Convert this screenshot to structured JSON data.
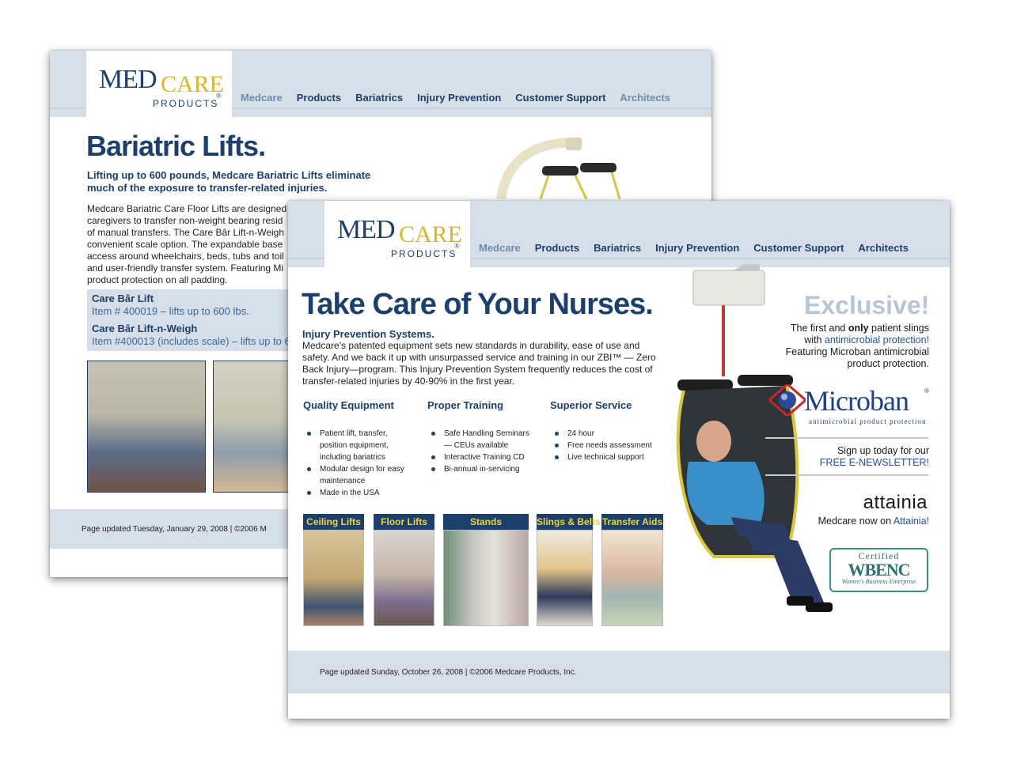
{
  "brand": {
    "med": "MED",
    "care": "CARE",
    "reg": "®",
    "products": "PRODUCTS"
  },
  "nav": [
    "Medcare",
    "Products",
    "Bariatrics",
    "Injury Prevention",
    "Customer Support",
    "Architects"
  ],
  "back": {
    "title": "Bariatric Lifts.",
    "subtitle": "Lifting up to 600 pounds, Medcare Bariatric Lifts eliminate much of the exposure to transfer-related injuries.",
    "lines": [
      "Medcare Bariatric Care Floor Lifts are designed",
      "caregivers to transfer non-weight bearing resid",
      "of manual transfers. The Care Bâr Lift-n-Weigh",
      "convenient scale option. The expandable base",
      "access around wheelchairs, beds, tubs and toil",
      "and user-friendly transfer system. Featuring Mi",
      "product protection on all padding."
    ],
    "products": [
      {
        "name": "Care Bâr Lift",
        "desc": "Item # 400019 – lifts up to 600 lbs."
      },
      {
        "name": "Care Bâr Lift-n-Weigh",
        "desc": "Item #400013 (includes scale) – lifts up to 6"
      }
    ],
    "footer": "Page updated Tuesday, January 29, 2008   |   ©2006 M"
  },
  "front": {
    "title": "Take Care of Your Nurses.",
    "intro_heading": "Injury Prevention Systems.",
    "intro_lines": [
      "Medcare's patented equipment sets new standards in durability, ease of use and",
      "safety. And we back it up with unsurpassed service and training in our ZBI™ — Zero",
      "Back Injury—program. This Injury Prevention System frequently reduces the cost of",
      "transfer-related injuries by 40-90% in the first year."
    ],
    "columns": [
      {
        "heading": "Quality Equipment",
        "items": [
          "Patient lift, transfer,",
          "position equipment,",
          "including bariatrics",
          "Modular design for easy",
          "maintenance",
          "Made in the USA"
        ],
        "bullets": [
          0,
          3,
          5
        ]
      },
      {
        "heading": "Proper Training",
        "items": [
          "Safe Handling Seminars",
          "— CEUs available",
          "Interactive Training CD",
          "Bi-annual in-servicing"
        ],
        "bullets": [
          0,
          2,
          3
        ]
      },
      {
        "heading": "Superior Service",
        "items": [
          "24 hour",
          "Free needs assessment",
          "Live technical support"
        ],
        "bullets": [
          0,
          1,
          2
        ]
      }
    ],
    "categories": [
      "Ceiling Lifts",
      "Floor Lifts",
      "Stands",
      "Slings & Belts",
      "Transfer Aids"
    ],
    "exclusive": "Exclusive!",
    "excl_lines": {
      "a": "The first and ",
      "only": "only",
      "b": " patient slings",
      "c": "with ",
      "link": "antimicrobial protection!",
      "d": "Featuring Microban antimicrobial",
      "e": "product protection."
    },
    "microban": {
      "name": "Microban",
      "reg": "®",
      "tag": "antimicrobial product protection"
    },
    "signup": {
      "line1": "Sign up today for our",
      "link": "FREE E-NEWSLETTER!"
    },
    "attainia": {
      "logo": "attainia",
      "text": "Medcare now on ",
      "link": "Attainia!"
    },
    "wbenc": {
      "certified": "Certified",
      "name": "WBENC",
      "sub": "Women's Business Enterprise"
    },
    "footer": "Page updated Sunday, October 26, 2008   |   ©2006 Medcare Products, Inc."
  }
}
